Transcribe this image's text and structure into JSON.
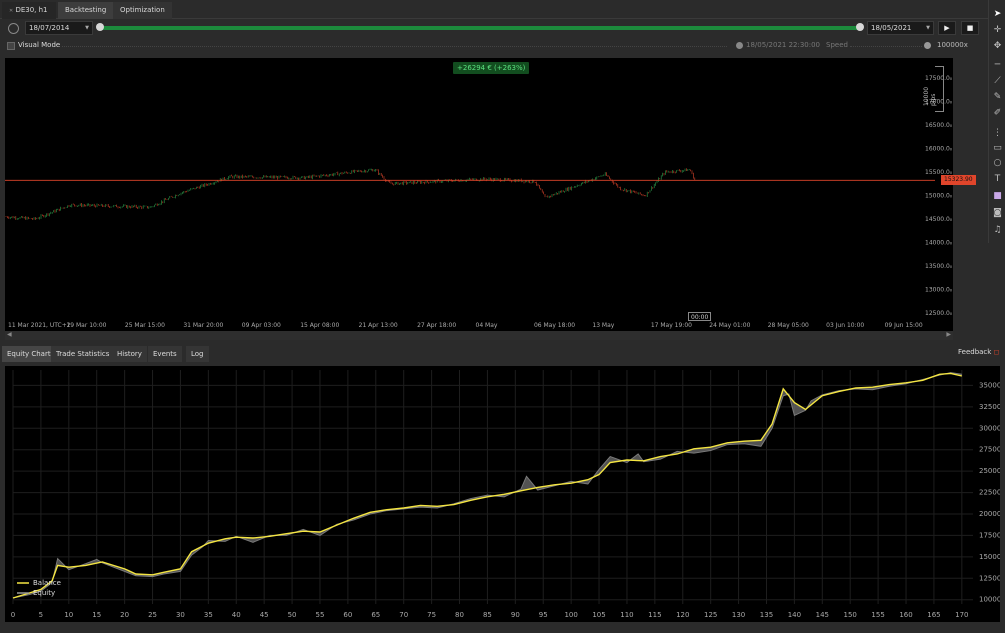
{
  "tabs": {
    "symbol": "DE30, h1",
    "backtesting": "Backtesting",
    "optimization": "Optimization"
  },
  "datebar": {
    "start_date": "18/07/2014",
    "end_date": "18/05/2021",
    "play": "▶",
    "stop": "■"
  },
  "visual_mode": {
    "label": "Visual Mode",
    "current_time": "18/05/2021 22:30:00",
    "speed_label": "Speed",
    "speed_value": "100000x"
  },
  "chart": {
    "pnl_badge": "+26294 € (+263%)",
    "pips_scale": "10000 pips",
    "current_price": "15323.90",
    "crosshair_time": "00:00",
    "price_ticks": [
      "17500.0̲",
      "17000.0̲",
      "16500.0̲",
      "16000.0̲",
      "15500.0̲",
      "15000.0̲",
      "14500.0̲",
      "14000.0̲",
      "13500.0̲",
      "13000.0̲",
      "12500.0̲"
    ],
    "price_tick_values": [
      17500,
      17000,
      16500,
      16000,
      15500,
      15000,
      14500,
      14000,
      13500,
      13000,
      12500
    ],
    "time_ticks": [
      "11 Mar 2021, UTC+2",
      "19 Mar 10:00",
      "25 Mar 15:00",
      "31 Mar 20:00",
      "09 Apr 03:00",
      "15 Apr 08:00",
      "21 Apr 13:00",
      "27 Apr 18:00",
      "04 May",
      "06 May 18:00",
      "13 May",
      "17 May 19:00",
      "24 May 01:00",
      "28 May 05:00",
      "03 Jun 10:00",
      "09 Jun 15:00"
    ],
    "colors": {
      "up": "#2ea44f",
      "down": "#e0452b",
      "price_line": "#e0452b",
      "badge_bg": "#124d1f"
    }
  },
  "bottom_tabs": [
    "Equity Chart",
    "Trade Statistics",
    "History",
    "Events",
    "Log"
  ],
  "feedback": "Feedback",
  "chart_data": {
    "type": "line",
    "title": "",
    "xlabel": "",
    "ylabel": "",
    "xlim": [
      0,
      172
    ],
    "ylim": [
      9500,
      36800
    ],
    "x_ticks": [
      0,
      5,
      10,
      15,
      20,
      25,
      30,
      35,
      40,
      45,
      50,
      55,
      60,
      65,
      70,
      75,
      80,
      85,
      90,
      95,
      100,
      105,
      110,
      115,
      120,
      125,
      130,
      135,
      140,
      145,
      150,
      155,
      160,
      165,
      170
    ],
    "y_ticks": [
      10000,
      12500,
      15000,
      17500,
      20000,
      22500,
      25000,
      27500,
      30000,
      32500,
      35000
    ],
    "legend": {
      "position": "bottom-left",
      "entries": [
        "Balance",
        "Equity"
      ]
    },
    "grid": true,
    "series": [
      {
        "name": "Balance",
        "color": "#f5e642",
        "x": [
          0,
          3,
          5,
          7,
          8,
          10,
          13,
          16,
          20,
          22,
          25,
          27,
          30,
          32,
          35,
          38,
          40,
          43,
          46,
          49,
          52,
          55,
          58,
          61,
          64,
          67,
          70,
          73,
          76,
          79,
          82,
          85,
          88,
          91,
          94,
          97,
          100,
          103,
          105,
          107,
          110,
          113,
          116,
          119,
          122,
          125,
          128,
          131,
          134,
          136,
          138,
          140,
          142,
          145,
          148,
          151,
          154,
          157,
          160,
          163,
          166,
          168,
          170
        ],
        "y": [
          10200,
          10800,
          11200,
          12200,
          14000,
          13800,
          14000,
          14400,
          13600,
          13000,
          12900,
          13200,
          13600,
          15600,
          16600,
          17100,
          17300,
          17200,
          17400,
          17700,
          18000,
          17900,
          18700,
          19500,
          20200,
          20500,
          20700,
          21000,
          20900,
          21100,
          21600,
          22000,
          22300,
          22700,
          23100,
          23400,
          23600,
          24000,
          24600,
          26000,
          26300,
          26200,
          26700,
          27000,
          27600,
          27800,
          28300,
          28500,
          28600,
          30500,
          34600,
          33000,
          32200,
          33800,
          34300,
          34700,
          34800,
          35100,
          35300,
          35600,
          36300,
          36400,
          36100
        ]
      },
      {
        "name": "Equity",
        "color": "#7a7a7a",
        "x": [
          0,
          3,
          5,
          7,
          8,
          10,
          13,
          15,
          16,
          20,
          22,
          25,
          27,
          30,
          32,
          34,
          35,
          38,
          40,
          43,
          46,
          49,
          52,
          55,
          58,
          61,
          64,
          67,
          70,
          73,
          76,
          79,
          82,
          85,
          88,
          91,
          92,
          94,
          97,
          100,
          103,
          105,
          107,
          110,
          112,
          113,
          116,
          119,
          122,
          125,
          128,
          131,
          134,
          136,
          138,
          139,
          140,
          142,
          143,
          145,
          148,
          151,
          154,
          157,
          160,
          163,
          166,
          168,
          170
        ],
        "y": [
          10200,
          10600,
          11000,
          12000,
          14800,
          13500,
          14200,
          14700,
          14300,
          13300,
          12800,
          12700,
          13000,
          13300,
          15200,
          16200,
          16900,
          16800,
          17400,
          16700,
          17500,
          17500,
          18200,
          17500,
          18800,
          19300,
          20000,
          20400,
          20600,
          20800,
          20700,
          21200,
          21800,
          22200,
          22000,
          22900,
          24400,
          22800,
          23300,
          23800,
          23500,
          25200,
          26700,
          26000,
          27000,
          26100,
          26400,
          27300,
          27100,
          27400,
          28100,
          28200,
          27900,
          30000,
          33800,
          34000,
          31500,
          32100,
          33200,
          33900,
          34400,
          34600,
          34500,
          34900,
          35200,
          35700,
          36200,
          36500,
          36300
        ]
      }
    ]
  }
}
